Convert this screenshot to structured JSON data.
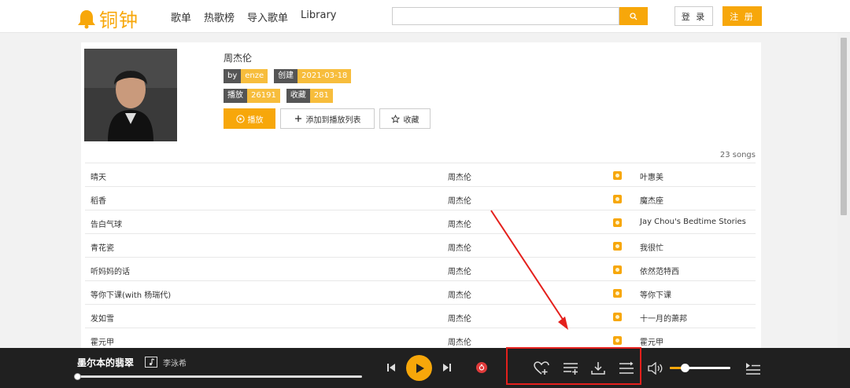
{
  "header": {
    "logo_text": "铜钟",
    "nav": [
      "歌单",
      "热歌榜",
      "导入歌单",
      "Library"
    ],
    "search": {
      "value": "",
      "placeholder": ""
    },
    "login_label": "登 录",
    "register_label": "注 册"
  },
  "playlist": {
    "title": "周杰伦",
    "tags": [
      [
        {
          "k": "by",
          "v": "enze"
        },
        {
          "k": "创建",
          "v": "2021-03-18"
        }
      ],
      [
        {
          "k": "播放",
          "v": "26191"
        },
        {
          "k": "收藏",
          "v": "281"
        }
      ]
    ],
    "play_label": "播放",
    "add_label": "添加到播放列表",
    "fav_label": "收藏",
    "song_count": "23 songs"
  },
  "songs": [
    {
      "name": "晴天",
      "artist": "周杰伦",
      "album": "叶惠美"
    },
    {
      "name": "稻香",
      "artist": "周杰伦",
      "album": "魔杰座"
    },
    {
      "name": "告白气球",
      "artist": "周杰伦",
      "album": "Jay Chou's Bedtime Stories"
    },
    {
      "name": "青花瓷",
      "artist": "周杰伦",
      "album": "我很忙"
    },
    {
      "name": "听妈妈的话",
      "artist": "周杰伦",
      "album": "依然范特西"
    },
    {
      "name": "等你下课(with 杨瑞代)",
      "artist": "周杰伦",
      "album": "等你下课"
    },
    {
      "name": "发如雪",
      "artist": "周杰伦",
      "album": "十一月的萧邦"
    },
    {
      "name": "霍元甲",
      "artist": "周杰伦",
      "album": "霍元甲"
    }
  ],
  "player": {
    "title": "墨尔本的翡翠",
    "artist": "李泳希",
    "progress": 0.0,
    "volume": 0.25
  },
  "colors": {
    "accent": "#f7a70a",
    "player_bg": "#202020",
    "annotation": "#e4201c"
  }
}
